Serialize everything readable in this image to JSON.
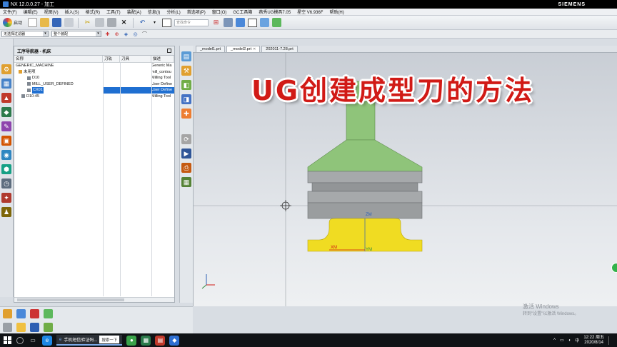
{
  "window": {
    "title": "NX 12.0.0.27 - 加工",
    "brand": "SIEMENS"
  },
  "menubar": [
    "文件(F)",
    "编辑(E)",
    "视图(V)",
    "插入(S)",
    "格式(R)",
    "工具(T)",
    "装配(A)",
    "信息(I)",
    "分析(L)",
    "首选项(P)",
    "窗口(O)",
    "GC工具箱",
    "燕秀UG模具7.05",
    "星空 V6.936F",
    "帮助(H)"
  ],
  "toolbar": {
    "start_label": "启动",
    "search_placeholder": "查找命令"
  },
  "selection_bar": {
    "filter_value": "无选择过滤器",
    "scope_value": "整个装配"
  },
  "navigator": {
    "title": "工序导航器 - 机床",
    "columns": [
      "名称",
      "刀轨",
      "刀具",
      "描述"
    ],
    "rows": [
      {
        "name": "GENERIC_MACHINE",
        "desc": "Generic Ma",
        "indent": 0,
        "selected": false
      },
      {
        "name": "未用项",
        "desc": "mill_contou",
        "indent": 1,
        "selected": false
      },
      {
        "name": "D10",
        "desc": "Milling Tool",
        "indent": 2,
        "selected": false
      },
      {
        "name": "MILL_USER_DEFINED",
        "desc": "User Define",
        "indent": 2,
        "selected": false
      },
      {
        "name": "CX01",
        "desc": "User Define",
        "indent": 2,
        "selected": true
      },
      {
        "name": "D10-45",
        "desc": "Milling Tool",
        "indent": 1,
        "selected": false
      }
    ]
  },
  "tabs": [
    {
      "label": "_model1.prt",
      "active": false
    },
    {
      "label": "_model2.prt",
      "active": true
    },
    {
      "label": "202011-7.28.prt",
      "active": false
    }
  ],
  "viewport": {
    "overlay_title": "UG创建成型刀的方法",
    "axis_zm": "ZM",
    "axis_xm": "XM",
    "axis_ym": "YM"
  },
  "watermark": {
    "line1": "激活 Windows",
    "line2": "转到\"设置\"以激活 Windows。"
  },
  "taskbar": {
    "active_window": "手机短信验证码...",
    "search_label": "搜索一下",
    "clock_time": "12:22 周五",
    "clock_date": "2020/8/14"
  },
  "colors": {
    "title_red": "#d11a16",
    "tool_green": "#8fc47a",
    "tool_gray": "#9a9d9f",
    "tool_yellow": "#f0dc22",
    "selection_blue": "#1f6fd1"
  }
}
